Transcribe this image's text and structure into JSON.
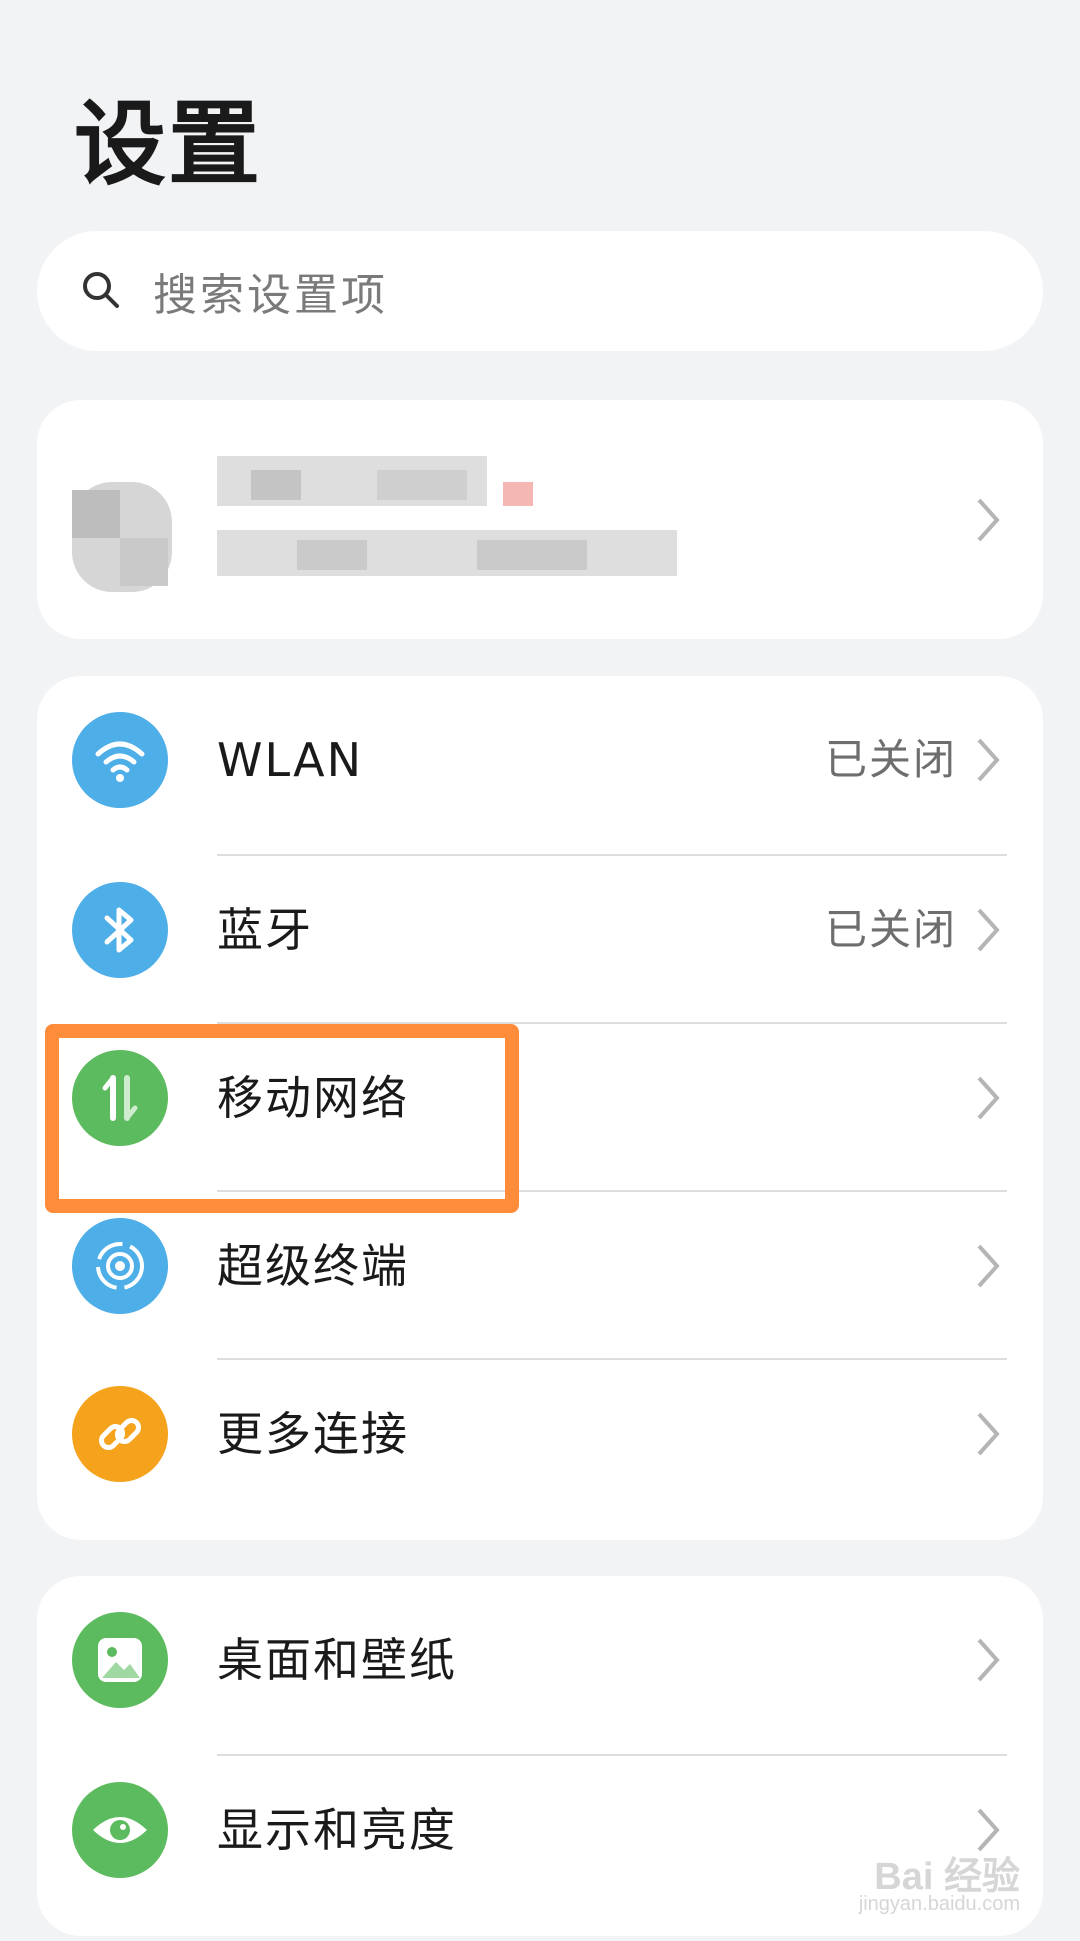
{
  "title": "设置",
  "search": {
    "placeholder": "搜索设置项"
  },
  "account": {
    "icon": "chevron-right-icon"
  },
  "connectivity": {
    "items": [
      {
        "label": "WLAN",
        "value": "已关闭",
        "icon": "wifi-icon",
        "color": "#4daee8"
      },
      {
        "label": "蓝牙",
        "value": "已关闭",
        "icon": "bluetooth-icon",
        "color": "#4daee8"
      },
      {
        "label": "移动网络",
        "value": "",
        "icon": "mobile-data-icon",
        "color": "#5cbb5e"
      },
      {
        "label": "超级终端",
        "value": "",
        "icon": "super-device-icon",
        "color": "#4daee8"
      },
      {
        "label": "更多连接",
        "value": "",
        "icon": "link-icon",
        "color": "#f5a21c"
      }
    ]
  },
  "display": {
    "items": [
      {
        "label": "桌面和壁纸",
        "icon": "wallpaper-icon",
        "color": "#5cbb5e"
      },
      {
        "label": "显示和亮度",
        "icon": "eye-icon",
        "color": "#5cbb5e"
      }
    ]
  },
  "watermark": {
    "text": "Bai 经验",
    "sub": "jingyan.baidu.com"
  },
  "colors": {
    "highlight": "#ff8c3b",
    "background": "#f1f3f5"
  }
}
